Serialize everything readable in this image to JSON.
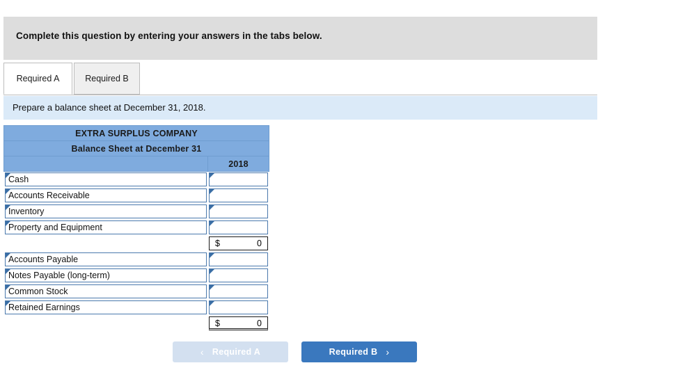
{
  "banner": {
    "text": "Complete this question by entering your answers in the tabs below."
  },
  "tabs": [
    {
      "label": "Required A",
      "active": true
    },
    {
      "label": "Required B",
      "active": false
    }
  ],
  "prompt": {
    "text": "Prepare a balance sheet at December 31, 2018."
  },
  "sheet": {
    "company": "EXTRA SURPLUS COMPANY",
    "statement": "Balance Sheet at December 31",
    "year_header": "2018",
    "asset_rows": [
      {
        "label": "Cash",
        "value": ""
      },
      {
        "label": "Accounts Receivable",
        "value": ""
      },
      {
        "label": "Inventory",
        "value": ""
      },
      {
        "label": "Property and Equipment",
        "value": ""
      }
    ],
    "asset_total": {
      "currency": "$",
      "amount": "0"
    },
    "liability_equity_rows": [
      {
        "label": "Accounts Payable",
        "value": ""
      },
      {
        "label": "Notes Payable (long-term)",
        "value": ""
      },
      {
        "label": "Common Stock",
        "value": ""
      },
      {
        "label": "Retained Earnings",
        "value": ""
      }
    ],
    "liability_equity_total": {
      "currency": "$",
      "amount": "0"
    }
  },
  "nav": {
    "prev_label": "Required A",
    "prev_icon": "chevron-left-icon",
    "prev_chevron": "‹",
    "next_label": "Required B",
    "next_icon": "chevron-right-icon",
    "next_chevron": "›"
  },
  "colors": {
    "banner_gray": "#dddddd",
    "prompt_blue": "#dbeaf8",
    "header_blue": "#7fabde",
    "input_border_blue": "#4a79ad",
    "button_blue": "#3a78be",
    "button_disabled": "#d3e0f0"
  }
}
